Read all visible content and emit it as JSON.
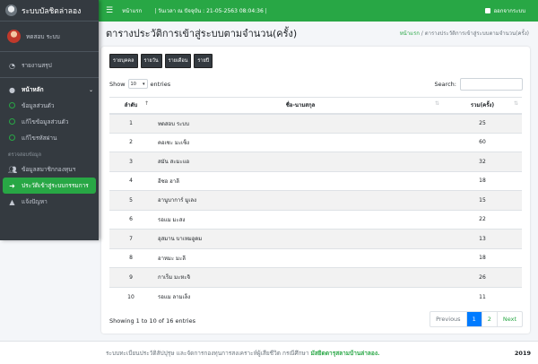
{
  "brand": {
    "name": "ระบบบัลชิตล่าลอง"
  },
  "user": {
    "name": "ทดสอบ ระบบ"
  },
  "sidebar": {
    "items": [
      {
        "label": "รายงานสรุป",
        "icon": "dashboard-icon"
      }
    ],
    "main_menu": {
      "label": "หน้าหลัก",
      "icon": "user-circle-icon"
    },
    "sub_items": [
      {
        "label": "ข้อมูลส่วนตัว"
      },
      {
        "label": "แก้ไขข้อมูลส่วนตัว"
      },
      {
        "label": "แก้ไขรหัสผ่าน"
      }
    ],
    "section_header": "ตรวจสอบข้อมูล",
    "section_items": [
      {
        "label": "ข้อมูลสมาชิกกองทุนฯ",
        "icon": "users-icon"
      },
      {
        "label": "ประวัติเข้าสู่ระบบกรรมการ",
        "icon": "login-icon",
        "active": true
      },
      {
        "label": "แจ้งปัญหา",
        "icon": "warning-icon"
      }
    ]
  },
  "topbar": {
    "home": "หน้าแรก",
    "datetime": "| วันเวลา ณ ปัจจุบัน : 21-05-2563 08:04:36 |",
    "logout": "ออกจากระบบ"
  },
  "header": {
    "title": "ตารางประวัติการเข้าสู่ระบบตามจำนวน(ครั้ง)",
    "breadcrumb_home": "หน้าแรก",
    "breadcrumb_current": " / ตารางประวัติการเข้าสู่ระบบตามจำนวน(ครั้ง)"
  },
  "buttons": [
    "รายบุคคล",
    "รายวัน",
    "รายเดือน",
    "รายปี"
  ],
  "length": {
    "show": "Show",
    "value": "10",
    "entries": "entries"
  },
  "search": {
    "label": "Search:"
  },
  "table": {
    "columns": [
      "ลำดับ",
      "ชื่อ-นามสกุล",
      "รวม(ครั้ง)"
    ],
    "rows": [
      {
        "idx": "1",
        "name": "ทดสอบ ระบบ",
        "count": "25"
      },
      {
        "idx": "2",
        "name": "คอเซะ มะเซ็ง",
        "count": "60"
      },
      {
        "idx": "3",
        "name": "สมัน สะมะแอ",
        "count": "32"
      },
      {
        "idx": "4",
        "name": "อีซอ ฮาลี",
        "count": "18"
      },
      {
        "idx": "5",
        "name": "อานูบาการ์ มูเลง",
        "count": "15"
      },
      {
        "idx": "6",
        "name": "รอแม มะสง",
        "count": "22"
      },
      {
        "idx": "7",
        "name": "อุสมาน บาเหมอูดม",
        "count": "13"
      },
      {
        "idx": "8",
        "name": "อาหมะ มะลี",
        "count": "18"
      },
      {
        "idx": "9",
        "name": "กาเร็ม มะหะจิ",
        "count": "26"
      },
      {
        "idx": "10",
        "name": "รอแม ลามเล็ง",
        "count": "11"
      }
    ]
  },
  "info": "Showing 1 to 10 of 16 entries",
  "pager": {
    "prev": "Previous",
    "p1": "1",
    "p2": "2",
    "next": "Next"
  },
  "footer": {
    "text": "ระบบทะเบียนประวัติสัปปุรุษ และจัดการกองทุนการสงเคราะห์ผู้เสียชีวิต กรณีศึกษา ",
    "link": "มัสยิดดารุสลามบ้านล่าลอง.",
    "year": "2019"
  },
  "colors": {
    "accent": "#28a745",
    "sidebar": "#343a40",
    "pager_active": "#007bff"
  }
}
